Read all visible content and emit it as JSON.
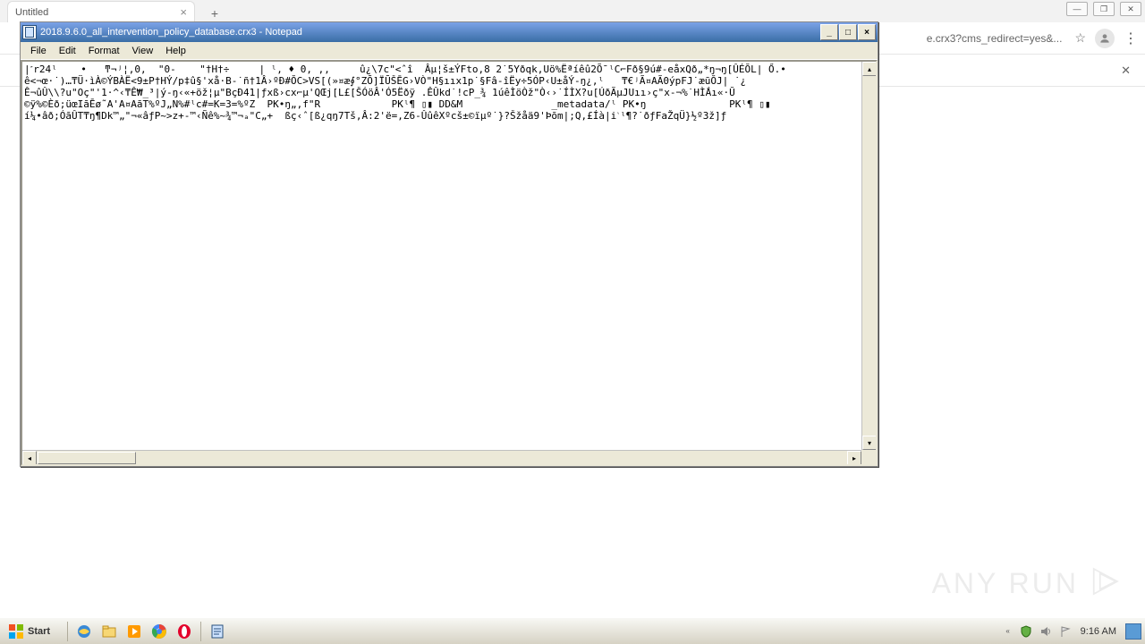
{
  "chrome": {
    "tab_title": "Untitled",
    "url_fragment": "e.crx3?cms_redirect=yes&...",
    "window_controls": {
      "min": "—",
      "max": "❐",
      "close": "✕"
    }
  },
  "notepad": {
    "title": "2018.9.6.0_all_intervention_policy_database.crx3 - Notepad",
    "menus": [
      "File",
      "Edit",
      "Format",
      "View",
      "Help"
    ],
    "window_controls": {
      "min": "_",
      "max": "□",
      "close": "×"
    },
    "content_lines": [
      "|˹r24ˡ    •   ͳ¬ʲ¦,0,  \"0-    \"†H†÷     | ˡ, ♦ 0, ,,     û¿\\7c\"<ˆî  Âµ¦š±ÝFto‚8 2˙5Yðqk‚Uö%Ëªíêû2Õ¯ˡC⌐Fð§9ú#-eåxQð„*ŋ¬ŋ[ÛÉŎL| Ő.•",
      "ê<¬œ·˙)…₸Ü·ìÀ©ÝBÀË<9±P†HÝ/p‡û§'xå·B-˙ñ†1Â›ºÐ#ŎC>VS[(»¤æ∮°ZŌ]ÏŪŠĒG›VÒ\"H§ııx1p˙§Fâ-îËy÷5ÓP‹U±åÝ-ŋ¿,ˡ   ₸€ʲÃ¤AÃ0ýpFJ˙æūŎJ| ˙¿",
      "Ê¬ûÛ\\\\?u\"Oç\"'1·^‹₸Ê₩_³|ý-ŋ‹«+öž¦µ\"BçÐ41|ƒxß›cx⌐µ'QŒj[L£[ŠÓöÂ'Ó5Ëðÿ .ÊÛkd˙!cP_¾ 1úêÌöÒž\"Ò‹›˙ÍÌX?u[ÚðÃµJUıı›ç\"x-¬%˙HÌ̌Áı«·Ŭ",
      "©ÿ%©Èð;üœIāĒø˜A'A¤AāT%ºJ„N%#ˡc#=K=3=%ºZ  PK•ŋ„‚f\"R            PKˡ¶ ▯▮ DD&M               _metadata/ˡ PK•ŋ              PKˡ¶ ▯▮",
      "í¼•âð;ÓāÛT₸ŋ¶Dk™„\"¬«âƒP~>z+-™‹Ñê%~¾™¬ₐ\"C„+  ßç‹ˆ[ß¿qŋ7Tš‚Â:2'ë=‚Z6-ÛûêXºcš±©ïµº˙}?Šžåä9'Þōm|;Q‚£Íà|i﮽ˡ¶?˙ðƒFaŽqÜ}½º3ž]ƒ"
    ]
  },
  "watermark": {
    "text": "ANY    RUN"
  },
  "taskbar": {
    "start_label": "Start",
    "clock": "9:16 AM"
  }
}
